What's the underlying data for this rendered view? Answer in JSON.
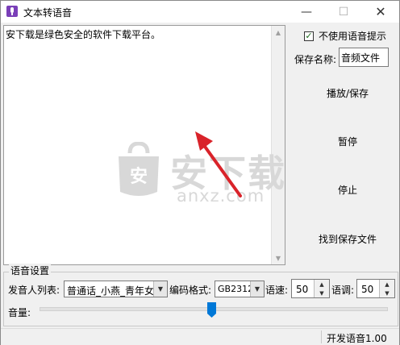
{
  "window": {
    "title": "文本转语音",
    "minimize": "—",
    "maximize": "☐",
    "close": "✕"
  },
  "editor": {
    "text": "安下载是绿色安全的软件下载平台。"
  },
  "watermark": {
    "main": "安下载",
    "sub": "anxz.com"
  },
  "options": {
    "no_voice_prompt_label": "不使用语音提示",
    "no_voice_prompt_checked": true,
    "save_name_label": "保存名称:",
    "save_name_value": "音频文件"
  },
  "actions": {
    "play_save": "播放/保存",
    "pause": "暂停",
    "stop": "停止",
    "find_saved": "找到保存文件"
  },
  "voice_settings": {
    "group_title": "语音设置",
    "speaker_label": "发音人列表:",
    "speaker_value": "普通话_小燕_青年女",
    "encoding_label": "编码格式:",
    "encoding_value": "GB2312",
    "speed_label": "语速:",
    "speed_value": "50",
    "pitch_label": "语调:",
    "pitch_value": "50",
    "volume_label": "音量:",
    "volume_level_fraction": 0.5
  },
  "status": {
    "text": "开发语音1.00"
  },
  "colors": {
    "arrow": "#d9232a",
    "checkmark": "#1a6b1a",
    "slider_thumb": "#0078d7",
    "app_icon": "#7a3fb8"
  }
}
